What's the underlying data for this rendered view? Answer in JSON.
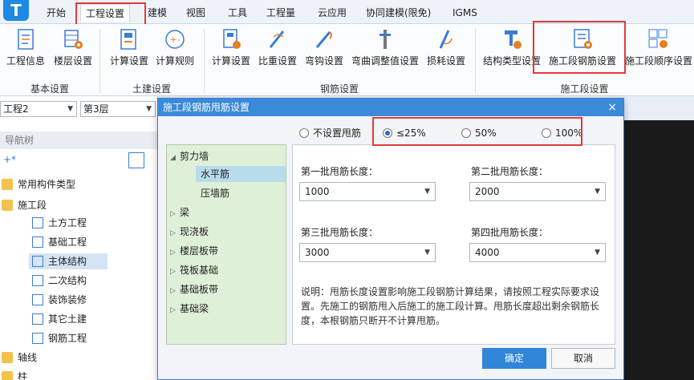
{
  "menubar": {
    "tabs": [
      {
        "label": "开始"
      },
      {
        "label": "工程设置"
      },
      {
        "label": "建模"
      },
      {
        "label": "视图"
      },
      {
        "label": "工具"
      },
      {
        "label": "工程量"
      },
      {
        "label": "云应用"
      },
      {
        "label": "协同建模(限免)"
      },
      {
        "label": "IGMS"
      }
    ]
  },
  "ribbon": {
    "buttons": [
      {
        "label": "工程信息",
        "icon": "doc-info-icon"
      },
      {
        "label": "楼层设置",
        "icon": "floor-settings-icon"
      },
      {
        "label": "计算设置",
        "icon": "calc-settings-icon"
      },
      {
        "label": "计算规则",
        "icon": "calc-rules-icon"
      },
      {
        "label": "计算设置",
        "icon": "rebar-calc-settings-icon"
      },
      {
        "label": "比重设置",
        "icon": "density-settings-icon"
      },
      {
        "label": "弯钩设置",
        "icon": "hook-settings-icon"
      },
      {
        "label": "弯曲调整值设置",
        "icon": "bend-adjust-icon"
      },
      {
        "label": "损耗设置",
        "icon": "loss-settings-icon"
      },
      {
        "label": "结构类型设置",
        "icon": "structure-type-icon"
      },
      {
        "label": "施工段钢筋设置",
        "icon": "segment-rebar-icon"
      },
      {
        "label": "施工段顺序设置",
        "icon": "segment-order-icon"
      }
    ],
    "groups": [
      {
        "label": "基本设置"
      },
      {
        "label": "土建设置"
      },
      {
        "label": "钢筋设置"
      },
      {
        "label": "施工段设置"
      }
    ]
  },
  "leftpanel": {
    "combo1": "工程2",
    "combo2": "第3层",
    "nav_title": "导航树",
    "items": [
      {
        "label": "常用构件类型"
      },
      {
        "label": "施工段"
      },
      {
        "label": "土方工程"
      },
      {
        "label": "基础工程"
      },
      {
        "label": "主体结构"
      },
      {
        "label": "二次结构"
      },
      {
        "label": "装饰装修"
      },
      {
        "label": "其它土建"
      },
      {
        "label": "钢筋工程"
      },
      {
        "label": "轴线"
      },
      {
        "label": "柱"
      }
    ]
  },
  "dialog": {
    "title": "施工段钢筋甩筋设置",
    "close_glyph": "×",
    "radios": [
      {
        "label": "不设置甩筋",
        "selected": false
      },
      {
        "label": "≤25%",
        "selected": true
      },
      {
        "label": "50%",
        "selected": false
      },
      {
        "label": "100%",
        "selected": false
      }
    ],
    "tree": [
      {
        "label": "剪力墙",
        "expanded": true
      },
      {
        "label": "水平筋"
      },
      {
        "label": "压墙筋"
      },
      {
        "label": "梁"
      },
      {
        "label": "现浇板"
      },
      {
        "label": "楼层板带"
      },
      {
        "label": "筏板基础"
      },
      {
        "label": "基础板带"
      },
      {
        "label": "基础梁"
      }
    ],
    "fields": [
      {
        "label": "第一批甩筋长度：",
        "value": "1000"
      },
      {
        "label": "第二批甩筋长度：",
        "value": "2000"
      },
      {
        "label": "第三批甩筋长度：",
        "value": "3000"
      },
      {
        "label": "第四批甩筋长度：",
        "value": "4000"
      }
    ],
    "note": "说明：甩筋长度设置影响施工段钢筋计算结果，请按照工程实际要求设置。先施工的钢筋甩入后施工的施工段计算。甩筋长度超出剩余钢筋长度，本根钢筋只断开不计算甩筋。",
    "ok_label": "确定",
    "cancel_label": "取消"
  }
}
